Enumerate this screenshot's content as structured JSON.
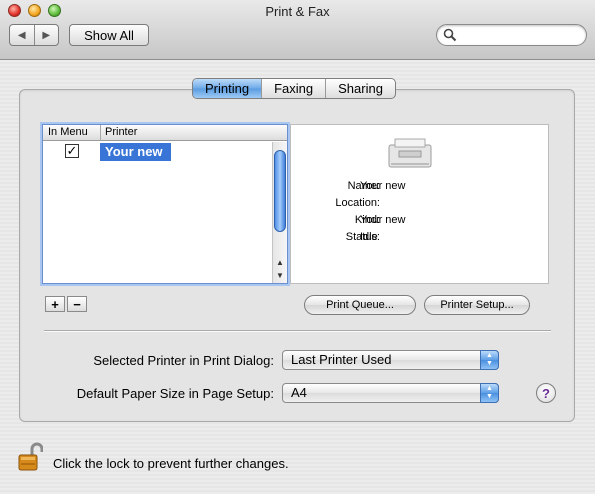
{
  "window": {
    "title": "Print & Fax"
  },
  "toolbar": {
    "back_glyph": "◀",
    "forward_glyph": "▶",
    "show_all_label": "Show All",
    "search_placeholder": "",
    "search_icon": "magnifier-icon"
  },
  "tabs": [
    {
      "label": "Printing",
      "selected": true
    },
    {
      "label": "Faxing",
      "selected": false
    },
    {
      "label": "Sharing",
      "selected": false
    }
  ],
  "printer_list": {
    "columns": [
      "In Menu",
      "Printer"
    ],
    "rows": [
      {
        "in_menu_checked": true,
        "check_glyph": "✓",
        "printer": "Your new",
        "selected": true
      }
    ]
  },
  "printer_details": {
    "fields": [
      {
        "label": "Name:",
        "value": "Your new"
      },
      {
        "label": "Location:",
        "value": ""
      },
      {
        "label": "Kind:",
        "value": "Your new"
      },
      {
        "label": "Status:",
        "value": "Idle"
      }
    ]
  },
  "list_buttons": {
    "add": "+",
    "remove": "−"
  },
  "actions": {
    "print_queue": "Print Queue...",
    "printer_setup": "Printer Setup..."
  },
  "settings": {
    "selected_printer_label": "Selected Printer in Print Dialog:",
    "selected_printer_value": "Last Printer Used",
    "paper_size_label": "Default Paper Size in Page Setup:",
    "paper_size_value": "A4"
  },
  "help_label": "?",
  "lock": {
    "text": "Click the lock to prevent further changes."
  },
  "colors": {
    "selection_blue": "#3875d7",
    "tab_selected": "#6ea9e8",
    "help_purple": "#6a2d94"
  }
}
